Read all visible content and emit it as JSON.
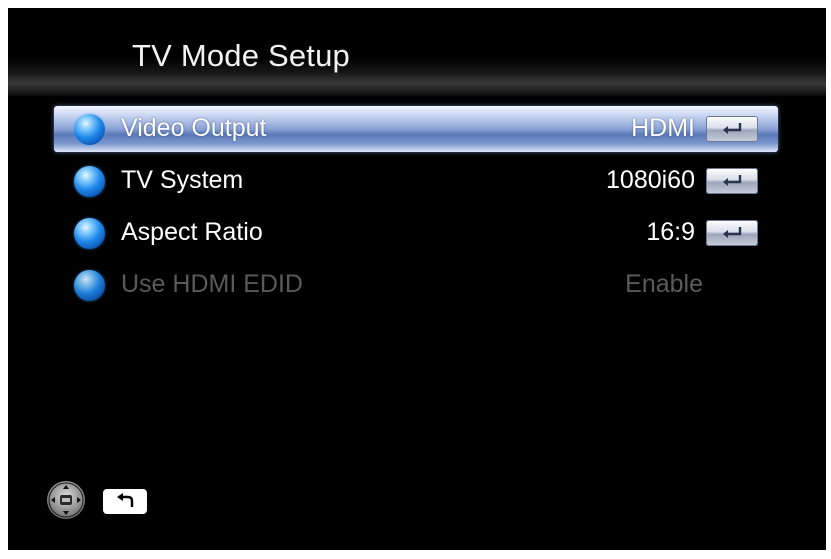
{
  "header": {
    "title": "TV Mode Setup"
  },
  "menu": {
    "items": [
      {
        "label": "Video Output",
        "value": "HDMI",
        "state": "selected",
        "action_icon": "enter-icon"
      },
      {
        "label": "TV System",
        "value": "1080i60",
        "state": "normal",
        "action_icon": "enter-icon"
      },
      {
        "label": "Aspect Ratio",
        "value": "16:9",
        "state": "normal",
        "action_icon": "enter-icon"
      },
      {
        "label": "Use HDMI EDID",
        "value": "Enable",
        "state": "disabled"
      }
    ],
    "bullet_icon": "blue-orb-icon"
  },
  "footer": {
    "icons": [
      "navigation-pad-icon",
      "back-return-icon"
    ]
  },
  "colors": {
    "background": "#000000",
    "text": "#ffffff",
    "disabled_text": "#5a5a5a",
    "selection": "#6f8bc8",
    "orb": "#1e88ea"
  }
}
